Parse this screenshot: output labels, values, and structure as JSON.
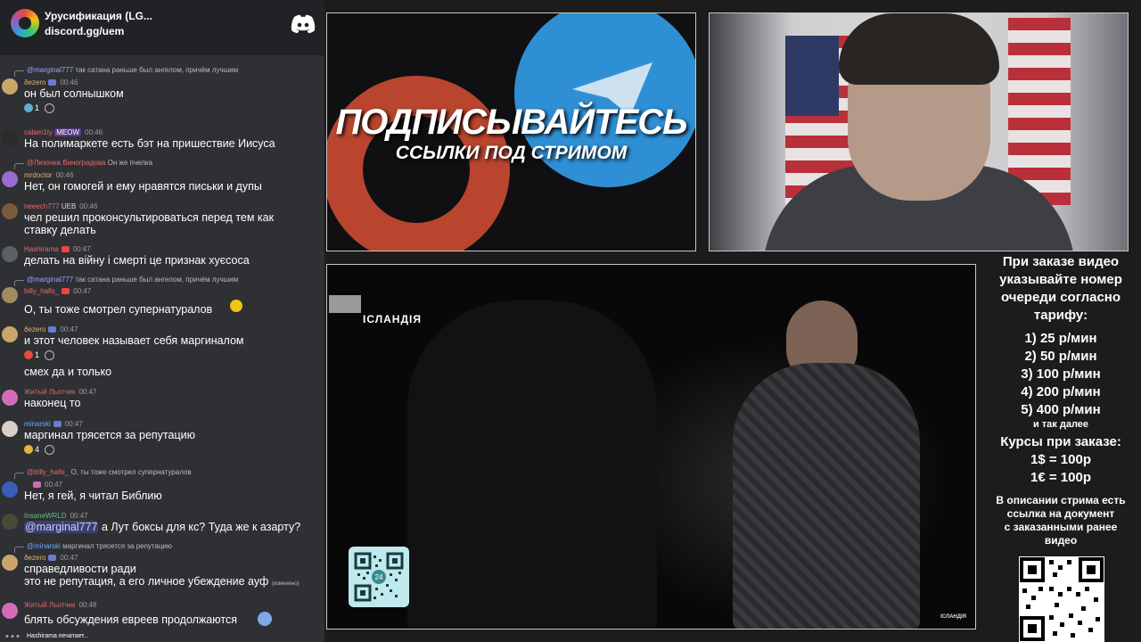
{
  "chat": {
    "server_name": "Урусификация (LG...",
    "invite": "discord.gg/uem",
    "typing": "Hashirama печатает...",
    "messages": [
      {
        "reply_to": "@marginal777",
        "reply_text": "так сатана раньше был ангелом, причём лучшим",
        "user": "ðezero",
        "time": "00:46",
        "text": "он был солнышком",
        "reactions": [
          {
            "count": "1"
          }
        ]
      },
      {
        "user": "calam1ty",
        "badge": "MEOW",
        "time": "00:46",
        "text": "На полимаркете есть бэт на пришествие Иисуса"
      },
      {
        "reply_to": "@Лизочка Виноградова",
        "reply_text": "Он же пчелка",
        "user": "mrdoctor",
        "time": "00:46",
        "text": "Нет, он гомогей и ему нравятся письки и дупы"
      },
      {
        "user": "neeech777",
        "badge": "UEB",
        "time": "00:46",
        "text": "чел решил проконсультироваться перед тем как ставку делать"
      },
      {
        "user": "Hashirama",
        "time": "00:47",
        "text": "делать на війну і смерті це признак хуєсоса"
      },
      {
        "reply_to": "@marginal777",
        "reply_text": "так сатана раньше был ангелом, причём лучшим",
        "user": "billy_halls_",
        "time": "00:47",
        "text": "О, ты тоже смотрел супернатуралов"
      },
      {
        "user": "ðezero",
        "time": "00:47",
        "text": "и этот человек называет себя маргиналом",
        "reactions": [
          {
            "count": "1"
          }
        ]
      },
      {
        "text": "смех да и только"
      },
      {
        "user": "Житый Льотчик",
        "time": "00:47",
        "text": "наконец то"
      },
      {
        "user": "minarski",
        "time": "00:47",
        "text": "маргинал трясется за репутацию",
        "reactions": [
          {
            "count": "4"
          }
        ]
      },
      {
        "reply_to": "@billy_halls_",
        "reply_text": "О, ты тоже смотрел супернатуралов",
        "user": "",
        "time": "00:47",
        "text": "Нет, я гей, я читал Библию"
      },
      {
        "user": "InsaneWRLD",
        "time": "00:47",
        "mention": "@marginal777",
        "text": " а Лут боксы для кс? Туда же к азарту?"
      },
      {
        "reply_to": "@minarski",
        "reply_text": "маргинал трясется за репутацию",
        "user": "ðezero",
        "time": "00:47",
        "text": "справедливости ради",
        "text2": "это не репутация, а его личное убеждение ауф",
        "edited": "(изменено)"
      },
      {
        "user": "Житый Льотчик",
        "time": "00:48",
        "text": "блять обсуждения евреев продолжаются"
      }
    ]
  },
  "promo": {
    "headline": "ПОДПИСЫВАЙТЕСЬ",
    "subline": "ССЫЛКИ ПОД СТРИМОМ"
  },
  "video": {
    "channel": "ІСЛАНДІЯ",
    "channel_small": "ІСЛАНДІЯ",
    "qr_label": "24"
  },
  "info": {
    "intro": [
      "При заказе видео",
      "указывайте номер",
      "очереди согласно",
      "тарифу:"
    ],
    "tariffs": [
      "1) 25 р/мин",
      "2) 50 р/мин",
      "3) 100 р/мин",
      "4) 200 р/мин",
      "5) 400 р/мин"
    ],
    "tariffs_more": "и так далее",
    "rates_title": "Курсы при заказе:",
    "rates": [
      "1$ = 100р",
      "1€ = 100р"
    ],
    "description": [
      "В описании стрима есть",
      "ссылка на документ",
      "с заказанными ранее",
      "видео"
    ]
  },
  "colors": {
    "usernames": [
      "#e0b36a",
      "#e66b6b",
      "#e0b36a",
      "#6ea8ff",
      "#e66b6b",
      "#d06b6b",
      "#e0b36a",
      "#e08a3a",
      "#5a9ee0",
      "#56c77b"
    ]
  }
}
